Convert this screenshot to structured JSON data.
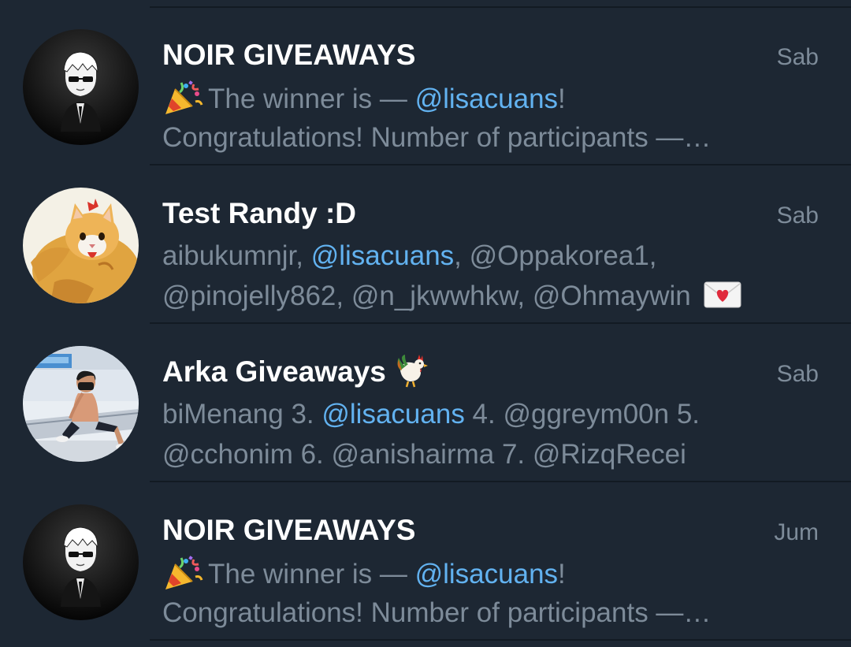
{
  "chats": [
    {
      "name": "NOIR GIVEAWAYS",
      "time": "Sab",
      "line1": {
        "pre": "The winner is — ",
        "mention": "@lisacuans",
        "post": "!"
      },
      "line2": "Congratulations!  Number of participants —…"
    },
    {
      "name": "Test Randy :D",
      "time": "Sab",
      "line1": {
        "pre": "aibukumnjr, ",
        "mention": "@lisacuans",
        "post": ", @Oppakorea1,"
      },
      "line2": "@pinojelly862, @n_jkwwhkw, @Ohmaywin"
    },
    {
      "name": "Arka Giveaways",
      "time": "Sab",
      "line1": {
        "pre": "biMenang 3. ",
        "mention": "@lisacuans",
        "post": " 4. @ggreym00n 5."
      },
      "line2": "@cchonim 6. @anishairma 7. @RizqRecei"
    },
    {
      "name": "NOIR GIVEAWAYS",
      "time": "Jum",
      "line1": {
        "pre": "The winner is — ",
        "mention": "@lisacuans",
        "post": "!"
      },
      "line2": "Congratulations!  Number of participants —…"
    }
  ],
  "icons": {
    "party": "party-popper-icon",
    "mail": "love-letter-icon",
    "rooster": "rooster-icon",
    "avatar_noir": "noir-avatar",
    "avatar_cat": "cat-chicken-avatar",
    "avatar_arka": "person-photo-avatar"
  },
  "colors": {
    "background": "#1d2733",
    "divider": "#121a23",
    "name": "#ffffff",
    "secondary": "#7d8b99",
    "mention": "#62b2f0"
  }
}
